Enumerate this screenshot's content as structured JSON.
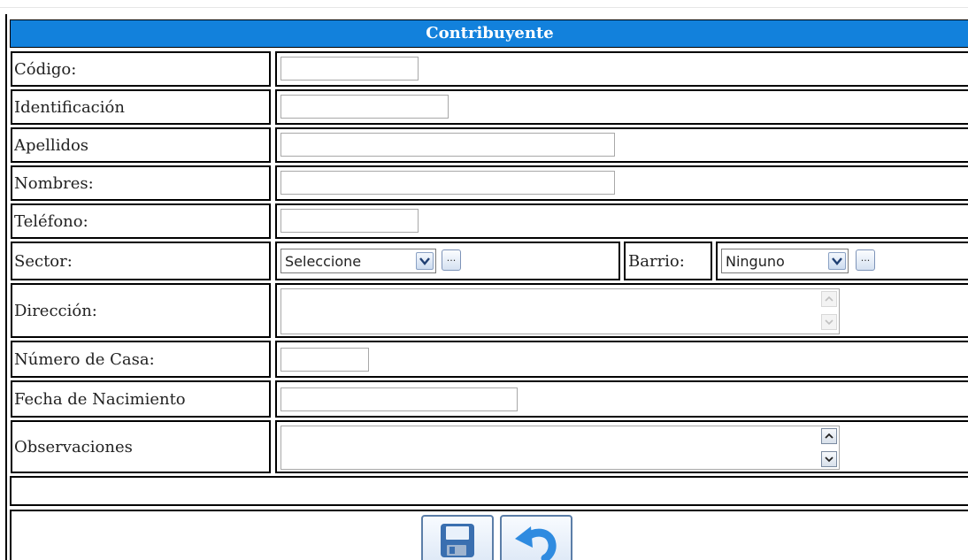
{
  "form": {
    "title": "Contribuyente",
    "codigo_label": "Código:",
    "codigo_value": "",
    "identificacion_label": "Identificación",
    "identificacion_value": "",
    "apellidos_label": "Apellidos",
    "apellidos_value": "",
    "nombres_label": "Nombres:",
    "nombres_value": "",
    "telefono_label": "Teléfono:",
    "telefono_value": "",
    "sector_label": "Sector:",
    "sector_selected": "Seleccione",
    "barrio_label": "Barrio:",
    "barrio_selected": "Ninguno",
    "ellipsis": "...",
    "direccion_label": "Dirección:",
    "direccion_value": "",
    "numero_casa_label": "Número de Casa:",
    "numero_casa_value": "",
    "fecha_nacimiento_label": "Fecha de Nacimiento",
    "fecha_nacimiento_value": "",
    "observaciones_label": "Observaciones",
    "observaciones_value": ""
  },
  "icons": {
    "save": "save-icon",
    "undo": "undo-icon",
    "dropdown": "chevron-down-icon"
  },
  "colors": {
    "title_bar": "#1281dc",
    "title_text": "#ffffff",
    "save_icon": "#3a6fb0",
    "undo_icon": "#2f8be0"
  }
}
